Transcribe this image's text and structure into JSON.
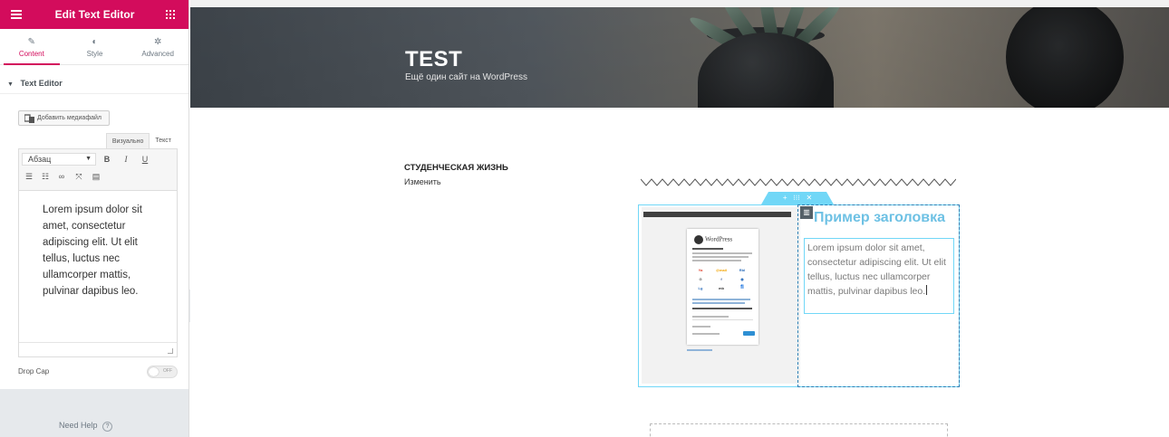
{
  "panel": {
    "title": "Edit Text Editor",
    "tabs": [
      {
        "label": "Content",
        "icon": "pencil-icon",
        "active": true
      },
      {
        "label": "Style",
        "icon": "contrast-icon",
        "active": false
      },
      {
        "label": "Advanced",
        "icon": "gear-icon",
        "active": false
      }
    ],
    "section_title": "Text Editor",
    "add_media_label": "Добавить медиафайл",
    "editor_tabs": {
      "visual": "Визуально",
      "text": "Текст"
    },
    "format_select": "Абзац",
    "toolbar": {
      "bold": "B",
      "italic": "I",
      "underline": "U"
    },
    "editor_text": "Lorem ipsum dolor sit amet, consectetur adipiscing elit. Ut elit tellus, luctus nec ullamcorper mattis, pulvinar dapibus leo.",
    "drop_cap_label": "Drop Cap",
    "drop_cap_toggle": "OFF",
    "need_help": "Need Help",
    "accent_color": "#d30c5c"
  },
  "site": {
    "title": "TEST",
    "tagline": "Ещё один сайт на WordPress"
  },
  "post": {
    "heading": "СТУДЕНЧЕСКАЯ ЖИЗНЬ",
    "edit_link": "Изменить"
  },
  "widget": {
    "section_controls": {
      "add": "+",
      "move": "⁝⁝⁝",
      "close": "✕"
    },
    "column_handle": "▥",
    "heading": "Пример заголовка",
    "text": "Lorem ipsum dolor sit amet, consectetur adipiscing elit. Ut elit tellus, luctus nec ullamcorper mattis, pulvinar dapibus leo.",
    "wp_brand": "WordPress",
    "heading_color": "#6ec1e4",
    "outline_color": "#71d7f7"
  }
}
